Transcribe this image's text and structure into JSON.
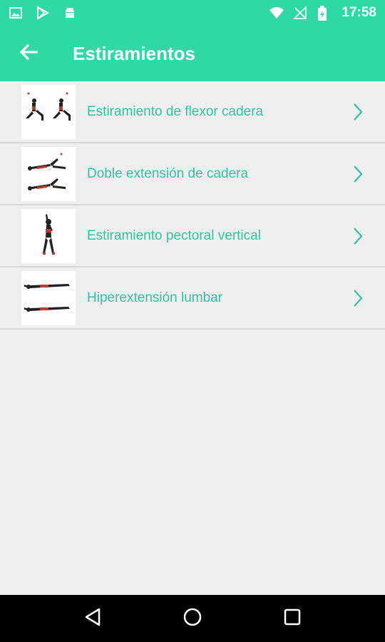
{
  "status_bar": {
    "time": "17:58",
    "left_icons": [
      "image-icon",
      "play-store-icon",
      "android-icon"
    ],
    "right_icons": [
      "wifi-icon",
      "no-signal-icon",
      "battery-icon"
    ]
  },
  "app_bar": {
    "title": "Estiramientos",
    "back_icon": "back-arrow-icon",
    "color": "#2ed9a7"
  },
  "exercises": [
    {
      "label": "Estiramiento de flexor cadera",
      "thumb": "hip-flexor-stretch-image"
    },
    {
      "label": "Doble extensión de cadera",
      "thumb": "double-hip-extension-image"
    },
    {
      "label": "Estiramiento pectoral vertical",
      "thumb": "vertical-pec-stretch-image"
    },
    {
      "label": "Hiperextensión lumbar",
      "thumb": "lumbar-hyperextension-image"
    }
  ],
  "nav_bar": {
    "buttons": [
      "back-triangle-icon",
      "home-circle-icon",
      "recents-square-icon"
    ]
  }
}
